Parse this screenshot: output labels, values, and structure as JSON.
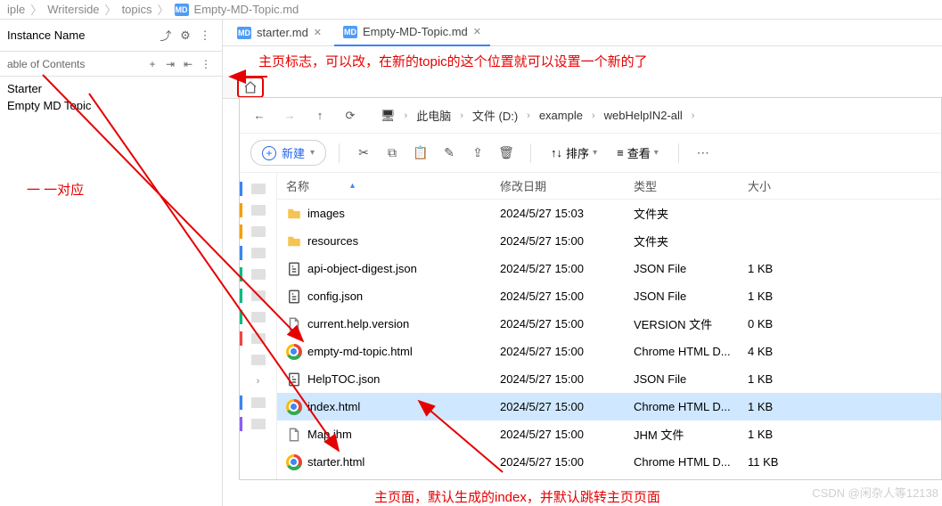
{
  "ide_breadcrumb": {
    "p1": "iple",
    "p2": "Writerside",
    "p3": "topics",
    "file_icon": "MD",
    "p4": "Empty-MD-Topic.md"
  },
  "instance": {
    "label": "Instance Name",
    "icons": [
      "exit",
      "gear",
      "more"
    ]
  },
  "toc": {
    "label": "able of Contents",
    "items": [
      "Starter",
      "Empty MD Topic"
    ]
  },
  "tabs": [
    {
      "icon": "MD",
      "label": "starter.md",
      "active": false
    },
    {
      "icon": "MD",
      "label": "Empty-MD-Topic.md",
      "active": true
    }
  ],
  "annotations": {
    "top": "主页标志，可以改，在新的topic的这个位置就可以设置一个新的了",
    "left": "一 一对应",
    "bottom": "主页面，默认生成的index，并默认跳转主页页面"
  },
  "explorer": {
    "crumbs": [
      "此电脑",
      "文件 (D:)",
      "example",
      "webHelpIN2-all"
    ],
    "toolbar": {
      "new": "新建",
      "sort": "排序",
      "view": "查看",
      "icons": [
        "cut",
        "copy",
        "paste",
        "rename",
        "share",
        "delete"
      ]
    },
    "headers": {
      "name": "名称",
      "date": "修改日期",
      "type": "类型",
      "size": "大小"
    },
    "files": [
      {
        "icon": "folder",
        "name": "images",
        "date": "2024/5/27 15:03",
        "type": "文件夹",
        "size": ""
      },
      {
        "icon": "folder",
        "name": "resources",
        "date": "2024/5/27 15:00",
        "type": "文件夹",
        "size": ""
      },
      {
        "icon": "json",
        "name": "api-object-digest.json",
        "date": "2024/5/27 15:00",
        "type": "JSON File",
        "size": "1 KB"
      },
      {
        "icon": "json",
        "name": "config.json",
        "date": "2024/5/27 15:00",
        "type": "JSON File",
        "size": "1 KB"
      },
      {
        "icon": "file",
        "name": "current.help.version",
        "date": "2024/5/27 15:00",
        "type": "VERSION 文件",
        "size": "0 KB"
      },
      {
        "icon": "chrome",
        "name": "empty-md-topic.html",
        "date": "2024/5/27 15:00",
        "type": "Chrome HTML D...",
        "size": "4 KB"
      },
      {
        "icon": "json",
        "name": "HelpTOC.json",
        "date": "2024/5/27 15:00",
        "type": "JSON File",
        "size": "1 KB"
      },
      {
        "icon": "chrome",
        "name": "index.html",
        "date": "2024/5/27 15:00",
        "type": "Chrome HTML D...",
        "size": "1 KB",
        "selected": true
      },
      {
        "icon": "file",
        "name": "Map.jhm",
        "date": "2024/5/27 15:00",
        "type": "JHM 文件",
        "size": "1 KB"
      },
      {
        "icon": "chrome",
        "name": "starter.html",
        "date": "2024/5/27 15:00",
        "type": "Chrome HTML D...",
        "size": "11 KB"
      }
    ]
  },
  "watermark": "CSDN @闲杂人等12138"
}
